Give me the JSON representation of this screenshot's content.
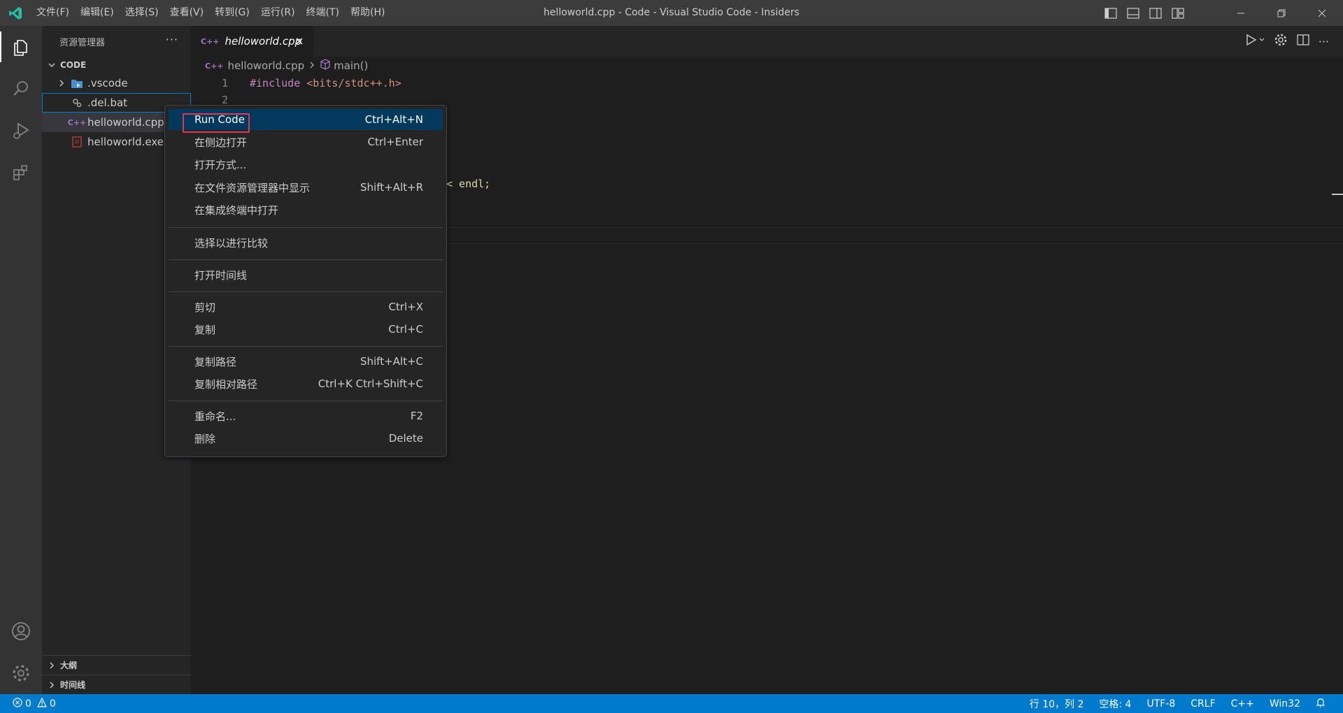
{
  "window": {
    "title": "helloworld.cpp - Code - Visual Studio Code - Insiders",
    "logo_icon": "vscode-insiders-logo",
    "accent_color": "#007acc"
  },
  "menu": [
    "文件(F)",
    "编辑(E)",
    "选择(S)",
    "查看(V)",
    "转到(G)",
    "运行(R)",
    "终端(T)",
    "帮助(H)"
  ],
  "sidebar": {
    "title": "资源管理器",
    "more": "···",
    "folder": "CODE",
    "items": [
      {
        "label": ".vscode",
        "icon": "vscode-folder-icon"
      },
      {
        "label": ".del.bat",
        "icon": "gear-file-icon"
      },
      {
        "label": "helloworld.cpp",
        "icon": "cpp-file-icon"
      },
      {
        "label": "helloworld.exe",
        "icon": "exe-file-icon"
      }
    ],
    "outline": "大纲",
    "timeline": "时间线"
  },
  "tab": {
    "label": "helloworld.cpp",
    "icon_text": "C++"
  },
  "breadcrumb": {
    "file": "helloworld.cpp",
    "symbol": "main()",
    "file_icon_text": "C++"
  },
  "editor": {
    "lines": [
      {
        "num": "1",
        "pre": "#include ",
        "inc": "<bits/stdc++.h>"
      },
      {
        "num": "2",
        "pre": "",
        "inc": ""
      }
    ],
    "fragment_visible": "< endl;"
  },
  "context_menu": {
    "items": [
      {
        "label": "Run Code",
        "key": "Ctrl+Alt+N"
      },
      {
        "label": "在侧边打开",
        "key": "Ctrl+Enter"
      },
      {
        "label": "打开方式...",
        "key": ""
      },
      {
        "label": "在文件资源管理器中显示",
        "key": "Shift+Alt+R"
      },
      {
        "label": "在集成终端中打开",
        "key": ""
      },
      {
        "label": "选择以进行比较",
        "key": ""
      },
      {
        "label": "打开时间线",
        "key": ""
      },
      {
        "label": "剪切",
        "key": "Ctrl+X"
      },
      {
        "label": "复制",
        "key": "Ctrl+C"
      },
      {
        "label": "复制路径",
        "key": "Shift+Alt+C"
      },
      {
        "label": "复制相对路径",
        "key": "Ctrl+K Ctrl+Shift+C"
      },
      {
        "label": "重命名...",
        "key": "F2"
      },
      {
        "label": "删除",
        "key": "Delete"
      }
    ]
  },
  "statusbar": {
    "errors": "0",
    "warnings": "0",
    "position": "行 10，列 2",
    "spaces": "空格: 4",
    "encoding": "UTF-8",
    "eol": "CRLF",
    "language": "C++",
    "platform": "Win32"
  }
}
